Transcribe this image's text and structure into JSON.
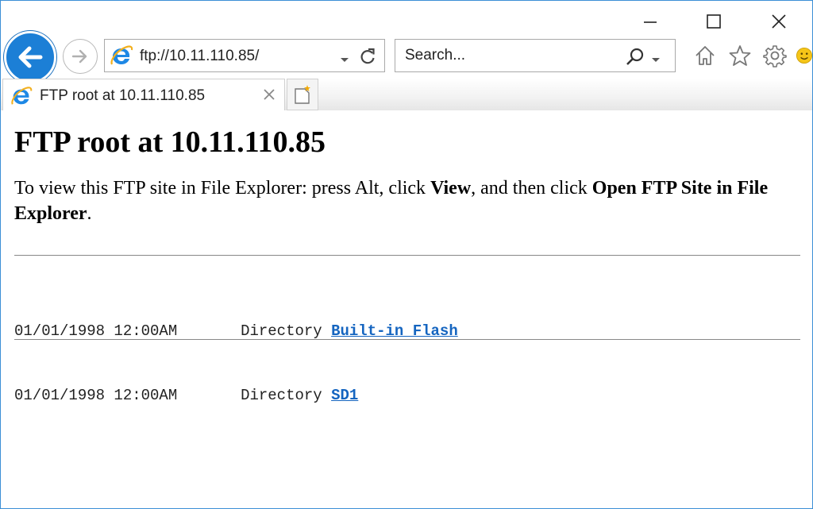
{
  "browser": {
    "address_url": "ftp://10.11.110.85/",
    "search_placeholder": "Search...",
    "tab_title": "FTP root at 10.11.110.85"
  },
  "page": {
    "heading": "FTP root at 10.11.110.85",
    "instructions": {
      "part1": "To view this FTP site in File Explorer: press Alt, click ",
      "view": "View",
      "part2": ", and then click ",
      "open": "Open FTP Site in File Explorer",
      "end": "."
    },
    "entries": [
      {
        "date": "01/01/1998 12:00AM",
        "type": "Directory",
        "name": "Built-in Flash"
      },
      {
        "date": "01/01/1998 12:00AM",
        "type": "Directory",
        "name": "SD1"
      }
    ]
  },
  "colors": {
    "back_button": "#1c7fd6",
    "link": "#1565c0",
    "ie_logo": "#1e88e5"
  },
  "icons": [
    "minimize-icon",
    "maximize-icon",
    "close-icon",
    "back-arrow-icon",
    "forward-arrow-icon",
    "ie-logo-icon",
    "dropdown-icon",
    "refresh-icon",
    "search-icon",
    "home-icon",
    "favorites-star-icon",
    "settings-gear-icon",
    "smiley-feedback-icon",
    "tab-close-icon",
    "new-tab-icon"
  ]
}
